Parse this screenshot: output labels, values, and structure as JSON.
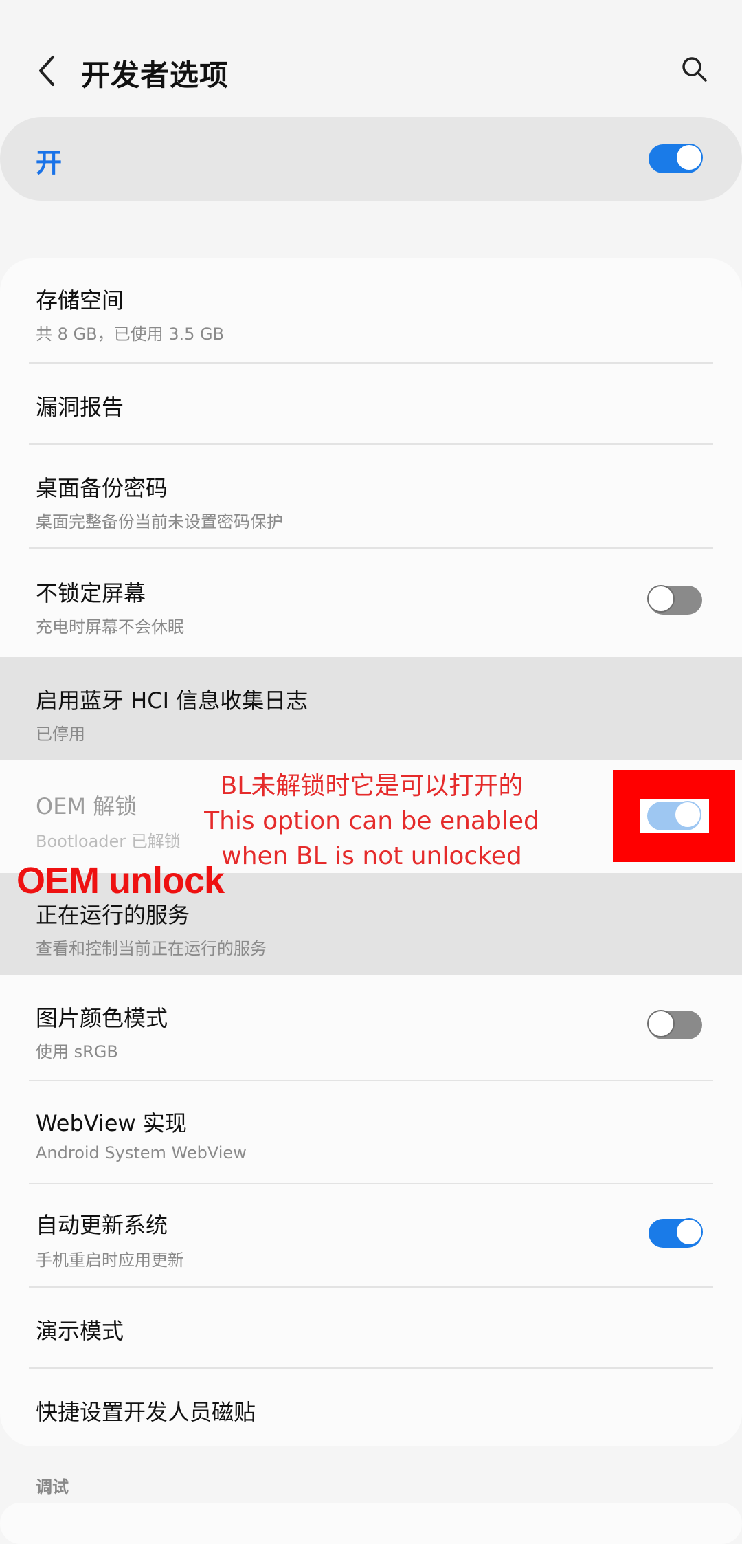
{
  "header": {
    "title": "开发者选项"
  },
  "master": {
    "label": "开",
    "state": "on"
  },
  "items": [
    {
      "title": "存储空间",
      "subtitle": "共 8 GB，已使用 3.5 GB"
    },
    {
      "title": "漏洞报告"
    },
    {
      "title": "桌面备份密码",
      "subtitle": "桌面完整备份当前未设置密码保护"
    },
    {
      "title": "不锁定屏幕",
      "subtitle": "充电时屏幕不会休眠",
      "toggle": "off"
    },
    {
      "title": "启用蓝牙 HCI 信息收集日志",
      "subtitle": "已停用"
    },
    {
      "title": "OEM 解锁",
      "subtitle": "Bootloader 已解锁",
      "toggle": "on",
      "disabled": true
    },
    {
      "title": "正在运行的服务",
      "subtitle": "查看和控制当前正在运行的服务"
    },
    {
      "title": "图片颜色模式",
      "subtitle": "使用 sRGB",
      "toggle": "off"
    },
    {
      "title": "WebView 实现",
      "subtitle": "Android System WebView"
    },
    {
      "title": "自动更新系统",
      "subtitle": "手机重启时应用更新",
      "toggle": "on"
    },
    {
      "title": "演示模式"
    },
    {
      "title": "快捷设置开发人员磁贴"
    }
  ],
  "section": {
    "debug_label": "调试"
  },
  "annotations": {
    "note_line1": "BL未解锁时它是可以打开的",
    "note_line2": "This option can be enabled",
    "note_line3": "when BL is not unlocked",
    "label": "OEM unlock"
  },
  "colors": {
    "accent": "#1a7be8",
    "annotation_red": "#ff0000"
  }
}
